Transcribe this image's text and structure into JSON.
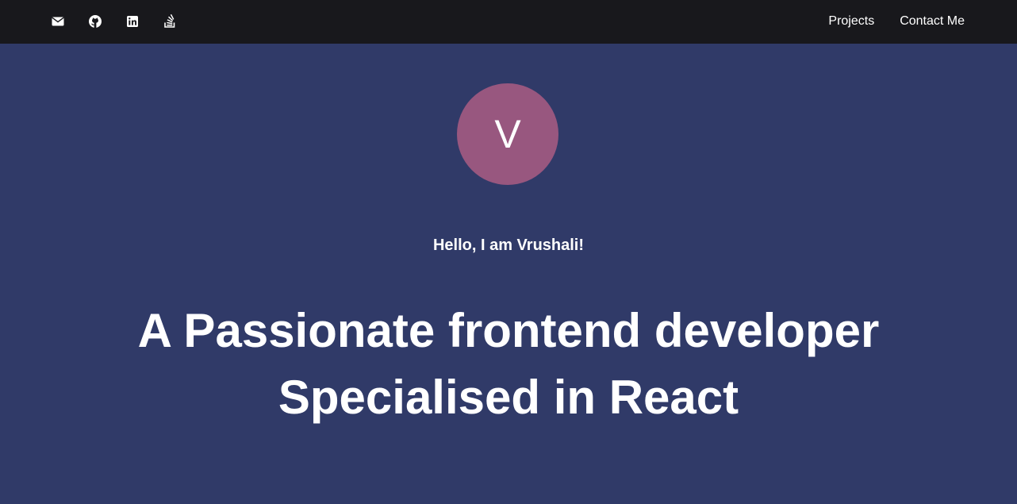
{
  "header": {
    "social_icons": [
      "envelope-icon",
      "github-icon",
      "linkedin-icon",
      "stackoverflow-icon"
    ],
    "nav": {
      "projects_label": "Projects",
      "contact_label": "Contact Me"
    }
  },
  "hero": {
    "avatar_letter": "V",
    "greeting": "Hello, I am Vrushali!",
    "headline_line1": "A Passionate frontend developer",
    "headline_line2": "Specialised in React"
  },
  "colors": {
    "topbar_bg": "#18181c",
    "page_bg": "#303a68",
    "avatar_bg": "#98577f",
    "text": "#ffffff"
  }
}
